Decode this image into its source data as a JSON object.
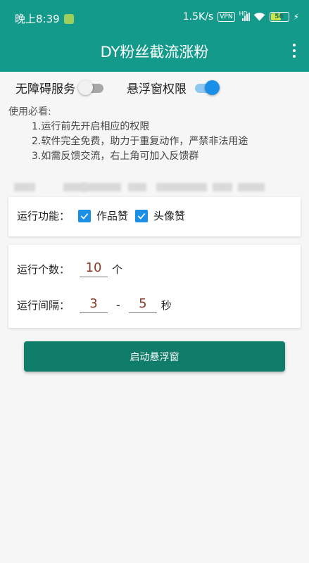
{
  "status_bar": {
    "time": "晚上8:39",
    "speed": "1.5K/s",
    "vpn": "VPN",
    "hd": "HD",
    "battery": "56",
    "battery_level": 0.56
  },
  "app_bar": {
    "title": "DY粉丝截流涨粉"
  },
  "toggles": {
    "accessibility_label": "无障碍服务",
    "accessibility_on": false,
    "floating_label": "悬浮窗权限",
    "floating_on": true
  },
  "notice": {
    "heading": "使用必看:",
    "items": [
      "1.运行前先开启相应的权限",
      "2.软件完全免费，助力于重复动作，严禁非法用途",
      "3.如需反馈交流，右上角可加入反馈群"
    ]
  },
  "function_card": {
    "label": "运行功能：",
    "options": [
      {
        "label": "作品赞",
        "checked": true
      },
      {
        "label": "头像赞",
        "checked": true
      }
    ]
  },
  "settings_card": {
    "count_label": "运行个数：",
    "count_value": "10",
    "count_unit": "个",
    "interval_label": "运行间隔：",
    "interval_min": "3",
    "interval_sep": "-",
    "interval_max": "5",
    "interval_unit": "秒"
  },
  "start_button": {
    "label": "启动悬浮窗"
  },
  "colors": {
    "primary": "#139a8a",
    "button": "#0f7d6a",
    "accent": "#1a8fe8",
    "value_text": "#8b3a2a"
  }
}
